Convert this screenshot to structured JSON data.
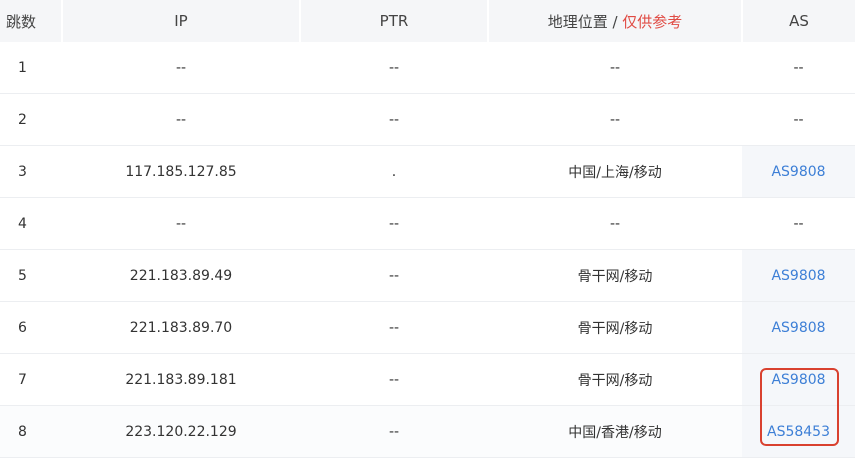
{
  "table": {
    "headers": {
      "hop": "跳数",
      "ip": "IP",
      "ptr": "PTR",
      "geo": "地理位置 / ",
      "geo_note": "仅供参考",
      "as": "AS"
    },
    "rows": [
      {
        "hop": "1",
        "ip": "--",
        "ptr": "--",
        "geo": "--",
        "as": "--"
      },
      {
        "hop": "2",
        "ip": "--",
        "ptr": "--",
        "geo": "--",
        "as": "--"
      },
      {
        "hop": "3",
        "ip": "117.185.127.85",
        "ptr": ".",
        "geo": "中国/上海/移动",
        "as": "AS9808"
      },
      {
        "hop": "4",
        "ip": "--",
        "ptr": "--",
        "geo": "--",
        "as": "--"
      },
      {
        "hop": "5",
        "ip": "221.183.89.49",
        "ptr": "--",
        "geo": "骨干网/移动",
        "as": "AS9808"
      },
      {
        "hop": "6",
        "ip": "221.183.89.70",
        "ptr": "--",
        "geo": "骨干网/移动",
        "as": "AS9808"
      },
      {
        "hop": "7",
        "ip": "221.183.89.181",
        "ptr": "--",
        "geo": "骨干网/移动",
        "as": "AS9808"
      },
      {
        "hop": "8",
        "ip": "223.120.22.129",
        "ptr": "--",
        "geo": "中国/香港/移动",
        "as": "AS58453"
      }
    ]
  },
  "colors": {
    "link": "#3d7fd6",
    "note": "#e04b44",
    "highlight_border": "#d9412f"
  }
}
